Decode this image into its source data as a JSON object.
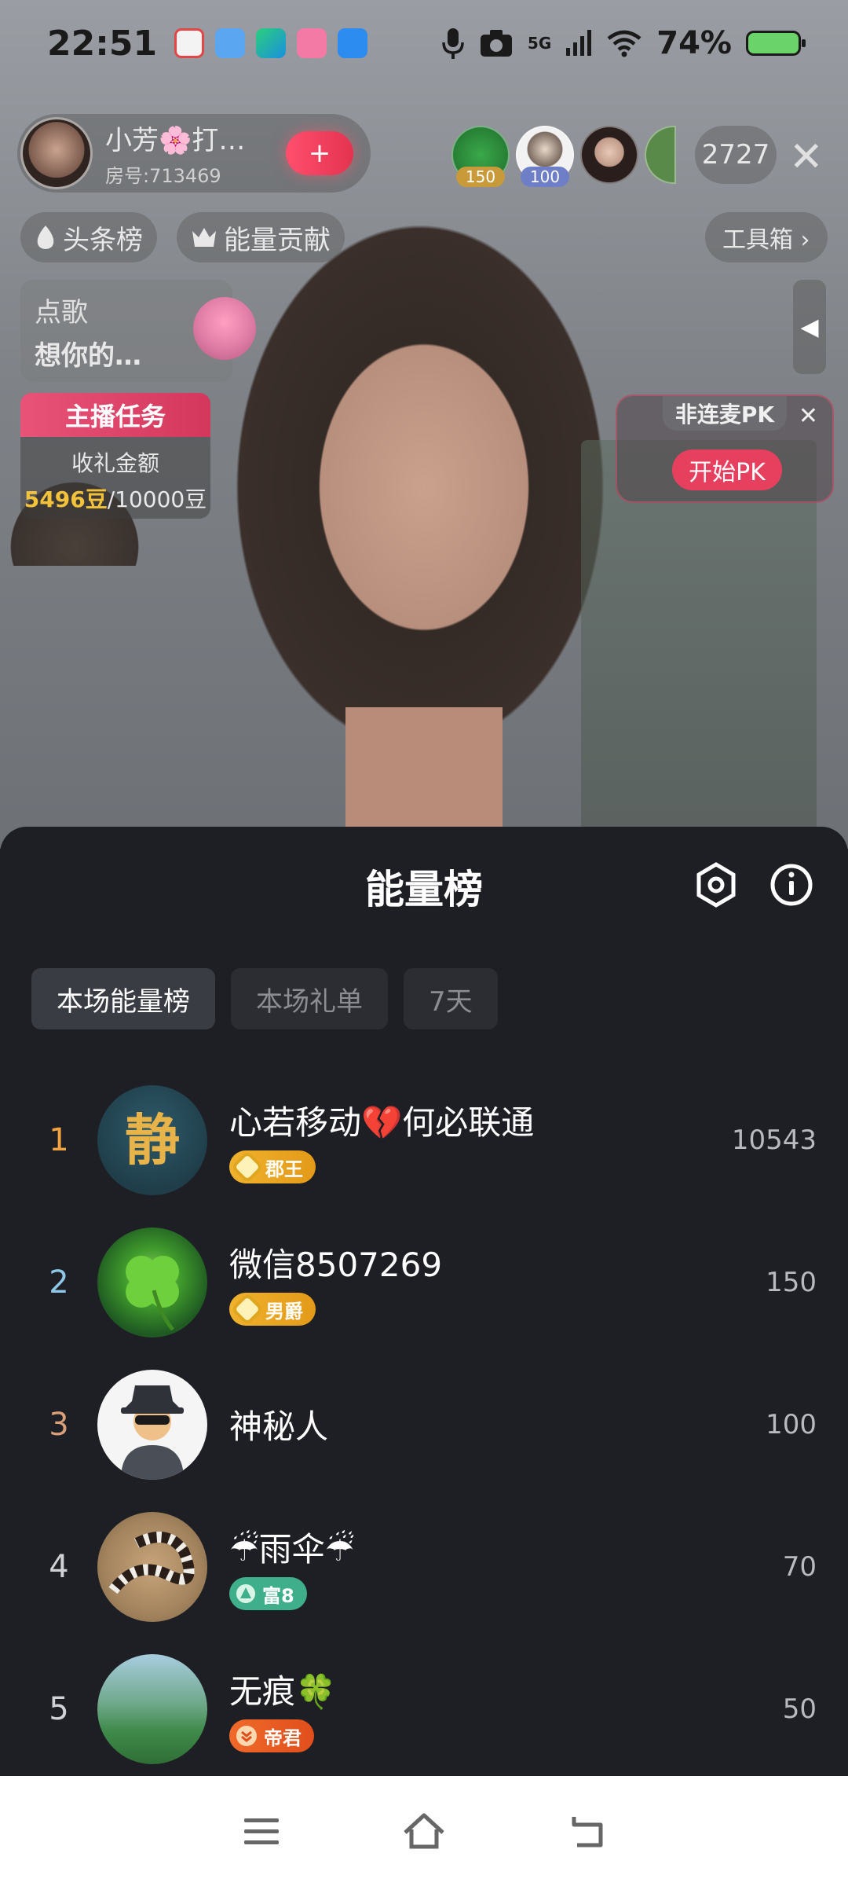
{
  "status_bar": {
    "time": "22:51",
    "network": "5G",
    "battery": "74%",
    "app_icons": [
      "app-icon-1",
      "app-icon-2",
      "app-icon-3",
      "app-icon-4",
      "app-icon-5"
    ]
  },
  "host": {
    "name": "小芳🌸打…",
    "room": "房号:713469",
    "follow_label": "+"
  },
  "viewers": [
    {
      "badge": "150",
      "color": "#c89a3a"
    },
    {
      "badge": "100",
      "color": "#6e7fc8"
    },
    {
      "badge": "",
      "color": ""
    },
    {
      "badge": "",
      "color": ""
    }
  ],
  "viewer_count": "2727",
  "chips": {
    "headline": "头条榜",
    "energy": "能量贡献",
    "toolbox": "工具箱 ›"
  },
  "song": {
    "line1": "点歌",
    "line2": "想你的…"
  },
  "task": {
    "header": "主播任务",
    "label": "收礼金额",
    "current": "5496豆",
    "target": "/10000豆"
  },
  "pk": {
    "label": "非连麦PK",
    "button": "开始PK"
  },
  "sheet": {
    "title": "能量榜",
    "tabs": [
      "本场能量榜",
      "本场礼单",
      "7天"
    ],
    "active_tab": "本场能量榜"
  },
  "ranking": [
    {
      "rank": "1",
      "name": "心若移动💔何必联通",
      "badge": "郡王",
      "score": "10543",
      "rank_color": "#f0a340",
      "badge_color": "#e8a020"
    },
    {
      "rank": "2",
      "name": "微信8507269",
      "badge": "男爵",
      "score": "150",
      "rank_color": "#8fc7e8",
      "badge_color": "#e8a020"
    },
    {
      "rank": "3",
      "name": "神秘人",
      "badge": "",
      "score": "100",
      "rank_color": "#d9a07a",
      "badge_color": ""
    },
    {
      "rank": "4",
      "name": "☔雨伞☔",
      "badge": "富8",
      "score": "70",
      "rank_color": "#d0d2d6",
      "badge_color": "#3fae8a"
    },
    {
      "rank": "5",
      "name": "无痕🍀",
      "badge": "帝君",
      "score": "50",
      "rank_color": "#d0d2d6",
      "badge_color": "#e8682a"
    }
  ],
  "nav": [
    "menu-icon",
    "home-icon",
    "back-icon"
  ]
}
